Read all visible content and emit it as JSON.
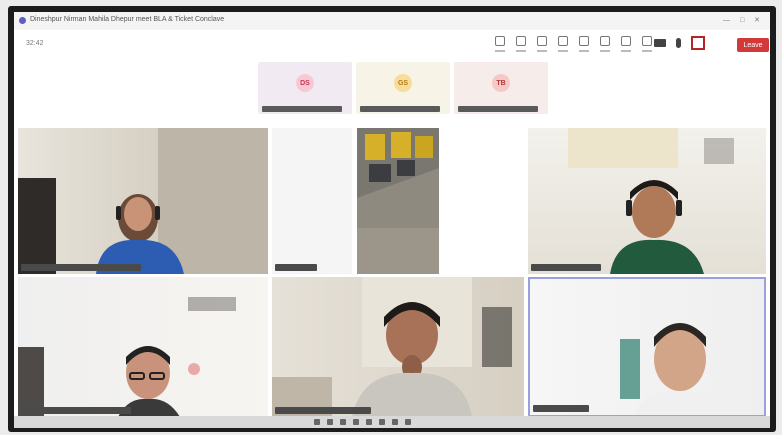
{
  "window": {
    "title": "Dineshpur Nirman Mahila Dhepur meet BLA & Ticket Conclave",
    "controls": "— □ ✕"
  },
  "toolbar": {
    "timer": "32:42",
    "icons": [
      "chat-icon",
      "people-icon",
      "raise-hand-icon",
      "react-icon",
      "view-icon",
      "rooms-icon",
      "apps-icon",
      "more-icon"
    ],
    "right_icons": [
      "camera-icon",
      "mic-icon",
      "share-icon"
    ],
    "leave_label": "Leave",
    "accent": "#5b5fc7",
    "leave_color": "#d23a3a"
  },
  "top_participants": [
    {
      "initials": "DS",
      "bg": "#f2eaf2",
      "avatar_color": "#f6c9d5",
      "text_color": "#c03a5a"
    },
    {
      "initials": "GS",
      "bg": "#f7f3e6",
      "avatar_color": "#f8dc9c",
      "text_color": "#b07b10"
    },
    {
      "initials": "TB",
      "bg": "#f6ecea",
      "avatar_color": "#f6c9c6",
      "text_color": "#b03a3a"
    }
  ],
  "video_tiles": [
    {
      "id": "tile-woman-headphones",
      "active": false
    },
    {
      "id": "tile-empty",
      "active": false
    },
    {
      "id": "tile-bus-yard",
      "active": false
    },
    {
      "id": "tile-man-headset",
      "active": false
    },
    {
      "id": "tile-man-glasses",
      "active": false
    },
    {
      "id": "tile-man-thinking",
      "active": false
    },
    {
      "id": "tile-man-speaking",
      "active": true
    }
  ]
}
